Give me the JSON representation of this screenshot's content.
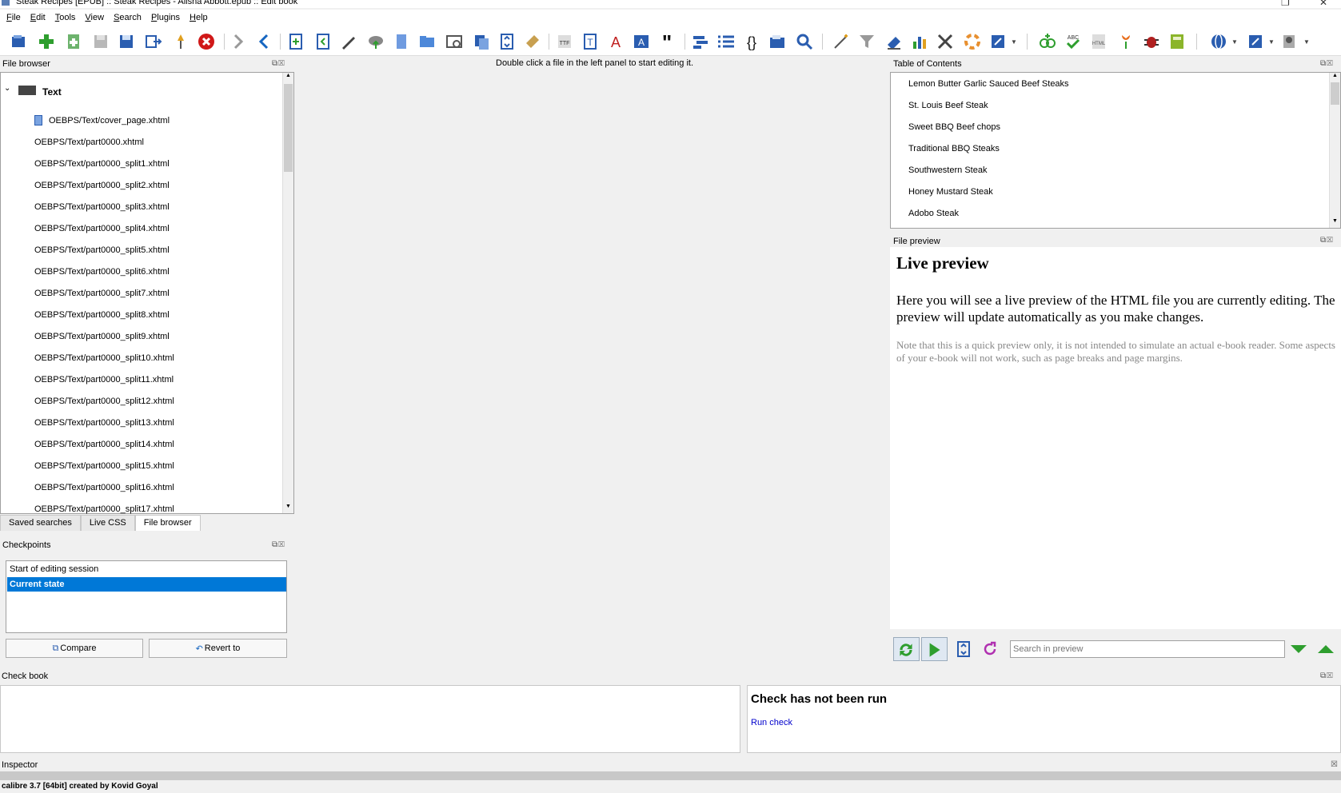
{
  "window": {
    "title": "Steak Recipes [EPUB] :: Steak Recipes - Alisha Abbott.epub :: Edit book"
  },
  "menu": [
    "File",
    "Edit",
    "Tools",
    "View",
    "Search",
    "Plugins",
    "Help"
  ],
  "editor": {
    "hint": "Double click a file in the left panel to start editing it."
  },
  "file_browser": {
    "title": "File browser",
    "root_label": "Text",
    "files": [
      "OEBPS/Text/cover_page.xhtml",
      "OEBPS/Text/part0000.xhtml",
      "OEBPS/Text/part0000_split1.xhtml",
      "OEBPS/Text/part0000_split2.xhtml",
      "OEBPS/Text/part0000_split3.xhtml",
      "OEBPS/Text/part0000_split4.xhtml",
      "OEBPS/Text/part0000_split5.xhtml",
      "OEBPS/Text/part0000_split6.xhtml",
      "OEBPS/Text/part0000_split7.xhtml",
      "OEBPS/Text/part0000_split8.xhtml",
      "OEBPS/Text/part0000_split9.xhtml",
      "OEBPS/Text/part0000_split10.xhtml",
      "OEBPS/Text/part0000_split11.xhtml",
      "OEBPS/Text/part0000_split12.xhtml",
      "OEBPS/Text/part0000_split13.xhtml",
      "OEBPS/Text/part0000_split14.xhtml",
      "OEBPS/Text/part0000_split15.xhtml",
      "OEBPS/Text/part0000_split16.xhtml",
      "OEBPS/Text/part0000_split17.xhtml"
    ],
    "tabs": [
      "Saved searches",
      "Live CSS",
      "File browser"
    ],
    "active_tab": "File browser"
  },
  "checkpoints": {
    "title": "Checkpoints",
    "items": [
      "Start of editing session",
      "Current state"
    ],
    "selected": "Current state",
    "compare_label": "Compare",
    "revert_label": "Revert to"
  },
  "toc": {
    "title": "Table of Contents",
    "items": [
      "Lemon Butter Garlic Sauced Beef Steaks",
      "St. Louis Beef Steak",
      "Sweet BBQ Beef chops",
      "Traditional BBQ Steaks",
      "Southwestern Steak",
      "Honey Mustard Steak",
      "Adobo Steak"
    ]
  },
  "file_preview": {
    "title": "File preview",
    "heading": "Live preview",
    "para1": "Here you will see a live preview of the HTML file you are currently editing. The preview will update automatically as you make changes.",
    "para2": "Note that this is a quick preview only, it is not intended to simulate an actual e-book reader. Some aspects of your e-book will not work, such as page breaks and page margins.",
    "search_placeholder": "Search in preview"
  },
  "check_book": {
    "title": "Check book",
    "status_heading": "Check has not been run",
    "run_link": "Run check"
  },
  "inspector": {
    "title": "Inspector"
  },
  "status": {
    "text": "calibre 3.7 [64bit] created by Kovid Goyal"
  },
  "colors": {
    "selection": "#0078d7",
    "link": "#0000cc",
    "accent_green": "#2e9e2e"
  }
}
